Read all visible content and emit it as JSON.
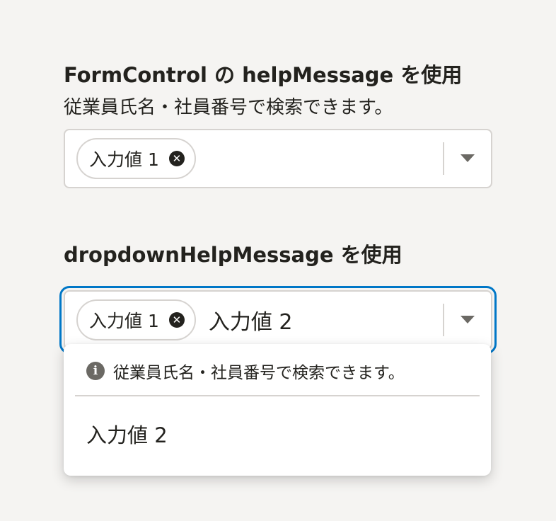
{
  "section1": {
    "title": "FormControl の helpMessage を使用",
    "help_message": "従業員氏名・社員番号で検索できます。",
    "selected_chips": [
      {
        "label": "入力値 1"
      }
    ],
    "chip_remove_icon": "close-icon",
    "toggle_icon": "caret-down-icon"
  },
  "section2": {
    "title": "dropdownHelpMessage を使用",
    "selected_chips": [
      {
        "label": "入力値 1"
      }
    ],
    "input_value": "入力値 2",
    "chip_remove_icon": "close-icon",
    "toggle_icon": "caret-down-icon",
    "focused": true
  },
  "dropdown": {
    "help_message": "従業員氏名・社員番号で検索できます。",
    "help_icon": "info-icon",
    "options": [
      {
        "label": "入力値 2"
      }
    ]
  },
  "colors": {
    "background": "#f5f4f2",
    "text": "#23221e",
    "border": "#d6d3d0",
    "focus": "#0077c7",
    "icon_gray": "#6b6964"
  }
}
